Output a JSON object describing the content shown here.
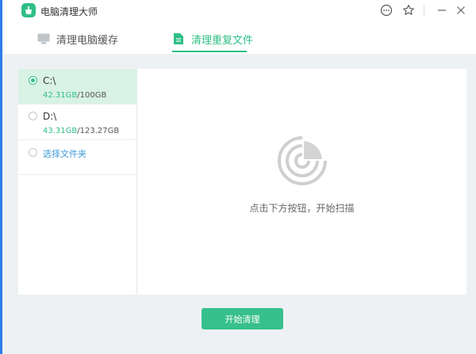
{
  "app": {
    "title": "电脑清理大师"
  },
  "titlebar": {
    "icons": [
      "more-icon",
      "star-icon",
      "minimize-icon",
      "close-icon"
    ]
  },
  "tabs": [
    {
      "label": "清理电脑缓存",
      "icon": "monitor-icon",
      "active": false
    },
    {
      "label": "清理重复文件",
      "icon": "document-icon",
      "active": true
    }
  ],
  "drives": [
    {
      "name": "C:\\",
      "used": "42.31GB",
      "separator": "/",
      "total": "100GB",
      "selected": true
    },
    {
      "name": "D:\\",
      "used": "43.31GB",
      "separator": "/",
      "total": "123.27GB",
      "selected": false
    }
  ],
  "folder_picker": {
    "label": "选择文件夹"
  },
  "empty_state": {
    "icon": "radar-scan-icon",
    "message": "点击下方按钮，开始扫描"
  },
  "actions": {
    "start_label": "开始清理"
  },
  "colors": {
    "accent": "#2fbf86",
    "link": "#3d9ad8",
    "selected_bg": "#d9f2e6",
    "window_border": "#2b7de9"
  }
}
